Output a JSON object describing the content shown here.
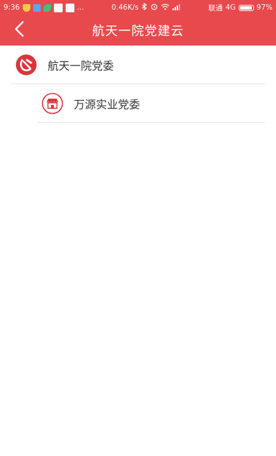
{
  "status_bar": {
    "time": "9:36",
    "speed": "0.46K/s",
    "carrier": "联通",
    "network": "4G",
    "battery": "97%",
    "more": "..."
  },
  "header": {
    "title": "航天一院党建云",
    "back_icon": "chevron-left-icon",
    "background": "#e8494c"
  },
  "list": {
    "items": [
      {
        "label": "航天一院党委",
        "icon": "party-emblem-icon",
        "level": 0
      },
      {
        "label": "万源实业党委",
        "icon": "storefront-icon",
        "level": 1
      }
    ]
  },
  "colors": {
    "accent": "#e8494c",
    "text": "#333333",
    "divider": "#e3e3e3"
  }
}
